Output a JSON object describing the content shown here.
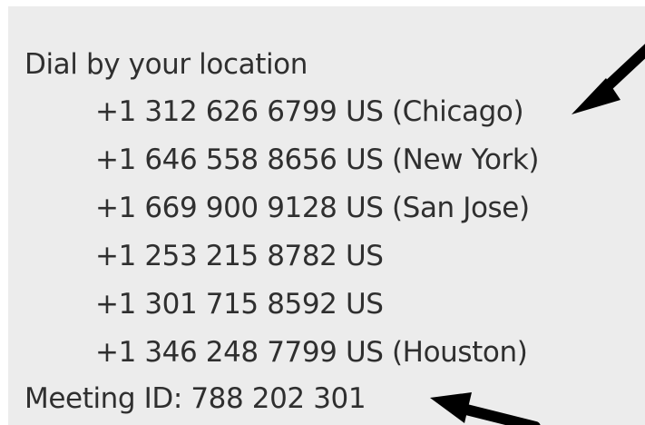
{
  "heading": "Dial by your location",
  "numbers": [
    "+1 312 626 6799 US (Chicago)",
    "+1 646 558 8656 US (New York)",
    "+1 669 900 9128 US (San Jose)",
    "+1 253 215 8782 US",
    "+1 301 715 8592 US",
    "+1 346 248 7799 US (Houston)"
  ],
  "meeting_id": "Meeting ID: 788 202 301",
  "colors": {
    "background": "#ececec",
    "text": "#2f2f2f",
    "arrow": "#000000"
  }
}
